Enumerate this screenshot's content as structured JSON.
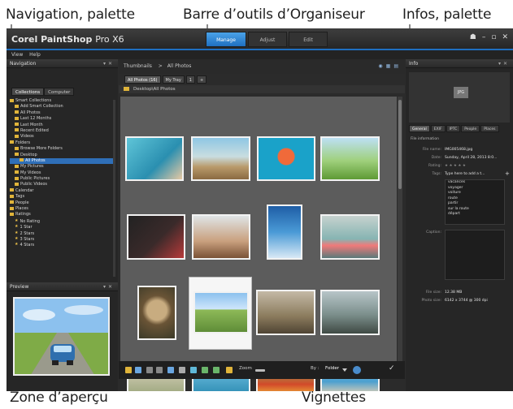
{
  "annotations": {
    "navigation_palette": "Navigation, palette",
    "organizer_toolbar": "Barre d’outils d’Organiseur",
    "info_palette": "Infos, palette",
    "preview_area": "Zone d’aperçu",
    "thumbnails": "Vignettes"
  },
  "app": {
    "title_bold": "Corel PaintShop",
    "title_suffix": "Pro X6",
    "tabs": [
      "Manage",
      "Adjust",
      "Edit"
    ],
    "active_tab": "Manage",
    "menu": [
      "View",
      "Help"
    ]
  },
  "navigation": {
    "header": "Navigation",
    "tabs": [
      "Collections",
      "Computer"
    ],
    "tree": [
      {
        "label": "Smart Collections",
        "icon": "folder"
      },
      {
        "label": "Add Smart Collection",
        "icon": "folder"
      },
      {
        "label": "All Photos",
        "icon": "folder"
      },
      {
        "label": "Last 12 Months",
        "icon": "folder"
      },
      {
        "label": "Last Month",
        "icon": "folder"
      },
      {
        "label": "Recent Edited",
        "icon": "folder"
      },
      {
        "label": "Videos",
        "icon": "folder"
      },
      {
        "label": "Folders",
        "icon": "folder"
      },
      {
        "label": "Browse More Folders",
        "icon": "folder"
      },
      {
        "label": "Desktop",
        "icon": "folder"
      },
      {
        "label": "All Photos",
        "icon": "folder",
        "selected": true
      },
      {
        "label": "My Pictures",
        "icon": "folder"
      },
      {
        "label": "My Videos",
        "icon": "folder"
      },
      {
        "label": "Public Pictures",
        "icon": "folder"
      },
      {
        "label": "Public Videos",
        "icon": "folder"
      },
      {
        "label": "Calendar",
        "icon": "folder"
      },
      {
        "label": "Tags",
        "icon": "folder"
      },
      {
        "label": "People",
        "icon": "folder"
      },
      {
        "label": "Places",
        "icon": "folder"
      },
      {
        "label": "Ratings",
        "icon": "folder"
      },
      {
        "label": "No Rating",
        "icon": "star"
      },
      {
        "label": "1 Star",
        "icon": "star"
      },
      {
        "label": "2 Stars",
        "icon": "star"
      },
      {
        "label": "3 Stars",
        "icon": "star"
      },
      {
        "label": "4 Stars",
        "icon": "star"
      }
    ]
  },
  "preview": {
    "header": "Preview"
  },
  "organizer": {
    "header": "Thumbnails",
    "breadcrumb_sep": ">",
    "breadcrumb_current": "All Photos",
    "filters": [
      "All Photos (16)",
      "My Tray",
      "1",
      "+"
    ],
    "path": "Desktop\\All Photos",
    "bottom_zoom_label": "Zoom",
    "bottom_sort_label": "By :",
    "bottom_sort_value": "Folder"
  },
  "info": {
    "header": "Info",
    "badge": "JPG",
    "tabs": [
      "General",
      "EXIF",
      "IPTC",
      "People",
      "Places"
    ],
    "section": "File information",
    "rows": [
      {
        "label": "File name:",
        "value": "IMG005468.jpg"
      },
      {
        "label": "Date:",
        "value": "Sunday, April 28, 2013 8:0..."
      },
      {
        "label": "Rating:",
        "value": "★ ★ ★ ★ ★"
      },
      {
        "label": "Tags:",
        "value": "Type here to add a t..."
      }
    ],
    "tags": [
      "vacances",
      "voyager",
      "voiture",
      "route",
      "partir",
      "sur la route",
      "départ"
    ],
    "caption_label": "Caption:",
    "size_rows": [
      {
        "label": "File size:",
        "value": "12.38 MB"
      },
      {
        "label": "Photo size:",
        "value": "6142 x 3744 @ 300 dpi"
      }
    ]
  },
  "colors": {
    "accent": "#1f6fc0",
    "chrome": "#2b2b2b",
    "grid_bg": "#5c5c5c",
    "callout": "#8a8a8a"
  }
}
